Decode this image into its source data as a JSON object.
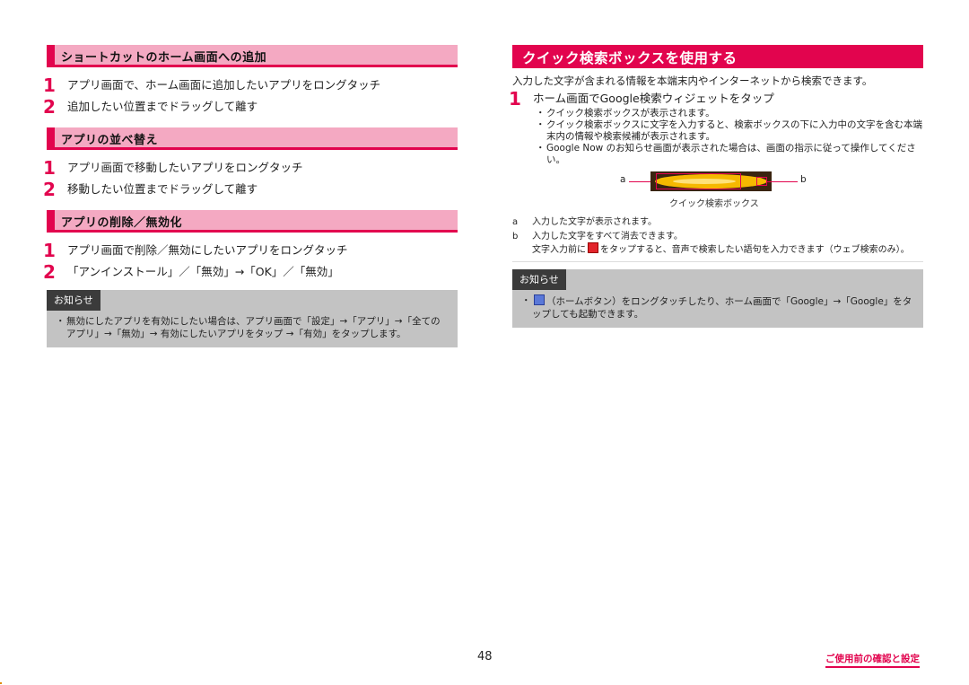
{
  "left": {
    "sections": [
      {
        "title": "ショートカットのホーム画面への追加",
        "steps": [
          {
            "num": "1",
            "text": "アプリ画面で、ホーム画面に追加したいアプリをロングタッチ"
          },
          {
            "num": "2",
            "text": "追加したい位置までドラッグして離す"
          }
        ]
      },
      {
        "title": "アプリの並べ替え",
        "steps": [
          {
            "num": "1",
            "text": "アプリ画面で移動したいアプリをロングタッチ"
          },
          {
            "num": "2",
            "text": "移動したい位置までドラッグして離す"
          }
        ]
      },
      {
        "title": "アプリの削除／無効化",
        "steps": [
          {
            "num": "1",
            "text": "アプリ画面で削除／無効にしたいアプリをロングタッチ"
          },
          {
            "num": "2",
            "text": "「アンインストール」／「無効」→「OK」／「無効」"
          }
        ]
      }
    ],
    "note": {
      "tag": "お知らせ",
      "bullet": "・",
      "text": "無効にしたアプリを有効にしたい場合は、アプリ画面で「設定」→「アプリ」→「全てのアプリ」→「無効」→ 有効にしたいアプリをタップ →「有効」をタップします。"
    }
  },
  "right": {
    "title": "クイック検索ボックスを使用する",
    "intro": "入力した文字が含まれる情報を本端末内やインターネットから検索できます。",
    "step": {
      "num": "1",
      "text": "ホーム画面でGoogle検索ウィジェットをタップ"
    },
    "bullets": [
      "クイック検索ボックスが表示されます。",
      "クイック検索ボックスに文字を入力すると、検索ボックスの下に入力中の文字を含む本端末内の情報や検索候補が表示されます。",
      "Google Now のお知らせ画面が表示された場合は、画面の指示に従って操作してください。"
    ],
    "figure": {
      "label_a": "a",
      "label_b": "b",
      "caption": "クイック検索ボックス"
    },
    "legend": [
      {
        "key": "a",
        "text": "入力した文字が表示されます。"
      },
      {
        "key": "b",
        "text": "入力した文字をすべて消去できます。"
      }
    ],
    "legend_extra_before": "文字入力前に",
    "legend_extra_after": "をタップすると、音声で検索したい語句を入力できます（ウェブ検索のみ）。",
    "note": {
      "tag": "お知らせ",
      "bullet": "・",
      "text_after_icon": "（ホームボタン）をロングタッチしたり、ホーム画面で「Google」→「Google」をタップしても起動できます。"
    }
  },
  "footer": {
    "page_number": "48",
    "chapter_link": "ご使用前の確認と設定"
  },
  "colors": {
    "accent": "#e2044e",
    "section_bg": "#f4a9c2",
    "note_bg": "#c3c3c3",
    "note_tag_bg": "#3b3b3b"
  }
}
